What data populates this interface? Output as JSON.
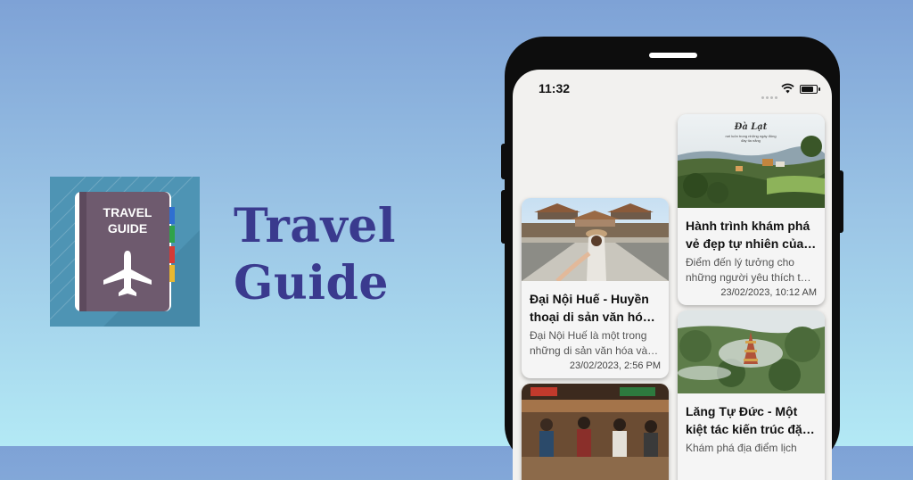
{
  "logo": {
    "lines": [
      "TRAVEL",
      "GUIDE"
    ],
    "icon": "airplane-icon",
    "bg_color": "#4e94b4",
    "book_color": "#6e5a6e"
  },
  "app_title": {
    "line1": "Travel",
    "line2": "Guide",
    "color": "#3a3a8e"
  },
  "status_bar": {
    "time": "11:32"
  },
  "cards": [
    {
      "title_lines": [
        "Hành trình khám phá",
        "vẻ đẹp tự nhiên của…"
      ],
      "desc_lines": [
        " Điểm đến lý tưởng cho",
        "những người yêu thích t…"
      ],
      "date": "23/02/2023, 10:12 AM",
      "image_caption": [
        "Đà Lạt",
        "nơi luôn trong những ngày đông",
        "đầy tia nắng"
      ],
      "image": "dalat-landscape"
    },
    {
      "title_lines": [
        "Đại Nội Huế - Huyền",
        "thoại di sản văn hóa…"
      ],
      "desc_lines": [
        "Đại Nội Huế là một trong",
        "những di sản văn hóa và…"
      ],
      "date": "23/02/2023, 2:56 PM",
      "image": "hue-citadel"
    },
    {
      "title_lines": [
        "Lăng Tự Đức - Một",
        "kiệt tác kiến trúc đặ…"
      ],
      "desc_lines": [
        "Khám phá địa điểm lịch"
      ],
      "date": "",
      "image": "pagoda-aerial"
    },
    {
      "title_lines": [],
      "desc_lines": [],
      "date": "",
      "image": "market-scene"
    }
  ]
}
